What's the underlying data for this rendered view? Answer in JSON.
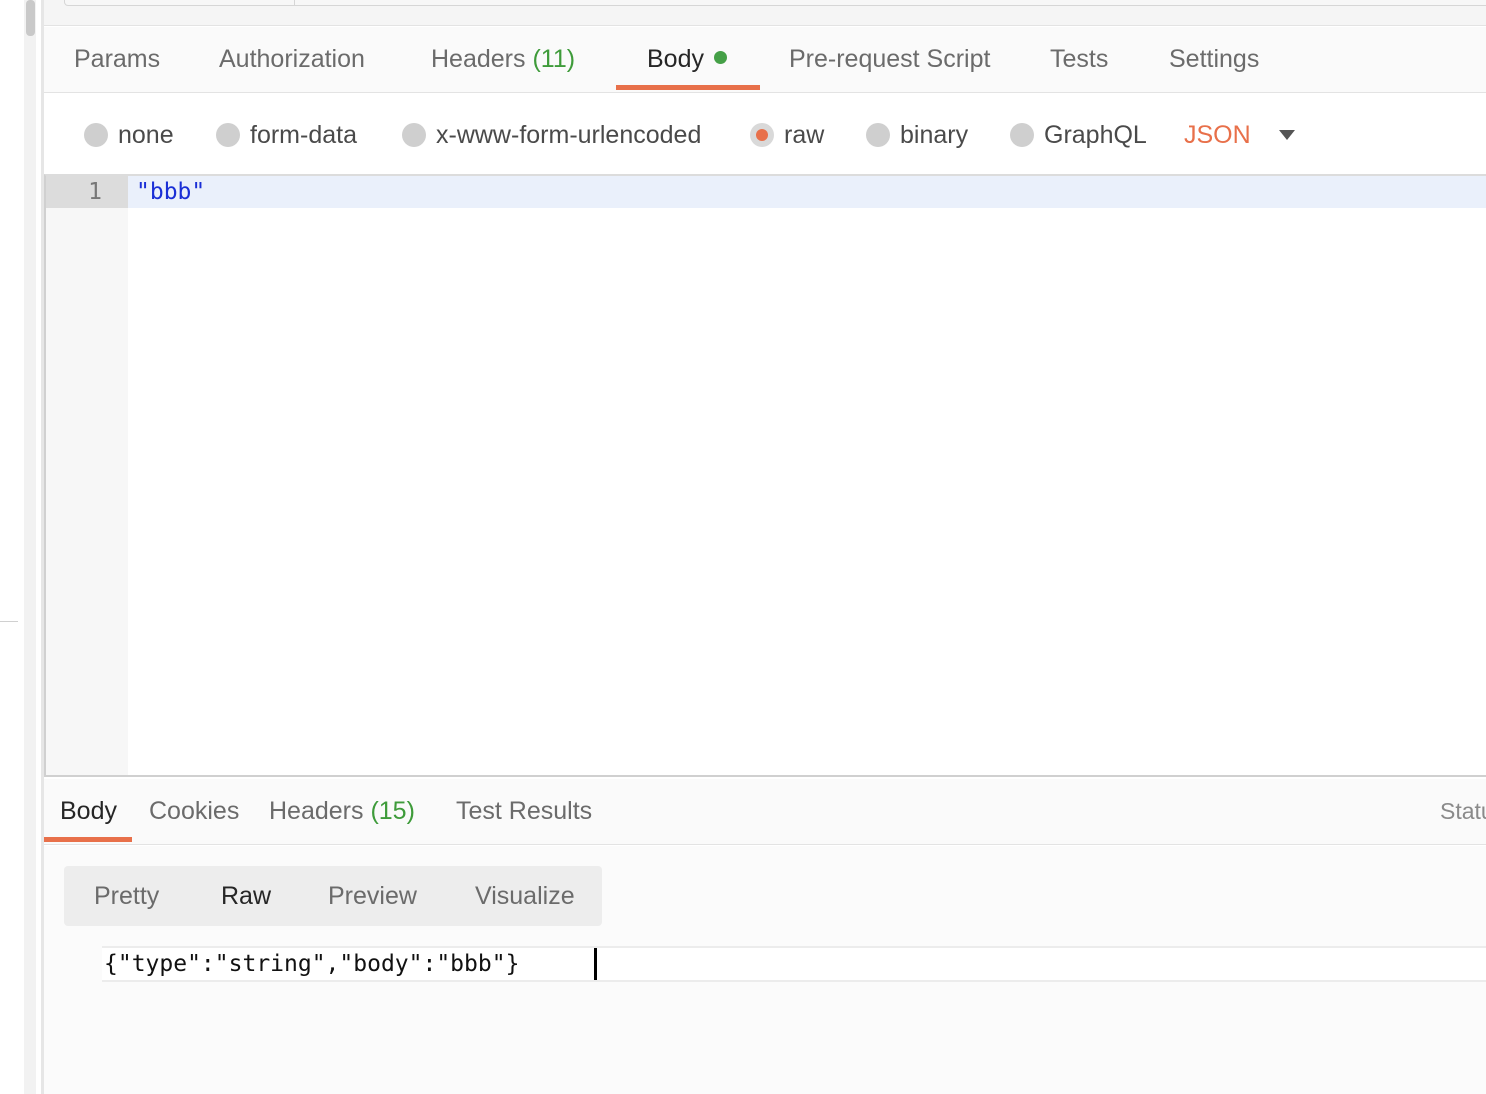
{
  "request_tabs": {
    "params": "Params",
    "authorization": "Authorization",
    "headers_label": "Headers",
    "headers_count": "(11)",
    "body": "Body",
    "pre_request_script": "Pre-request Script",
    "tests": "Tests",
    "settings": "Settings",
    "active": "Body"
  },
  "body_types": {
    "options": [
      "none",
      "form-data",
      "x-www-form-urlencoded",
      "raw",
      "binary",
      "GraphQL"
    ],
    "selected": "raw",
    "format": "JSON"
  },
  "editor": {
    "line_number": "1",
    "code": "\"bbb\""
  },
  "response_tabs": {
    "body": "Body",
    "cookies": "Cookies",
    "headers_label": "Headers",
    "headers_count": "(15)",
    "test_results": "Test Results",
    "status": "Statu",
    "active": "Body"
  },
  "view_modes": {
    "pretty": "Pretty",
    "raw": "Raw",
    "preview": "Preview",
    "visualize": "Visualize",
    "active": "Raw"
  },
  "response_raw": "{\"type\":\"string\",\"body\":\"bbb\"}",
  "colors": {
    "accent": "#e8704a",
    "count_green": "#3e9b3a",
    "string_blue": "#1a2fd6"
  }
}
